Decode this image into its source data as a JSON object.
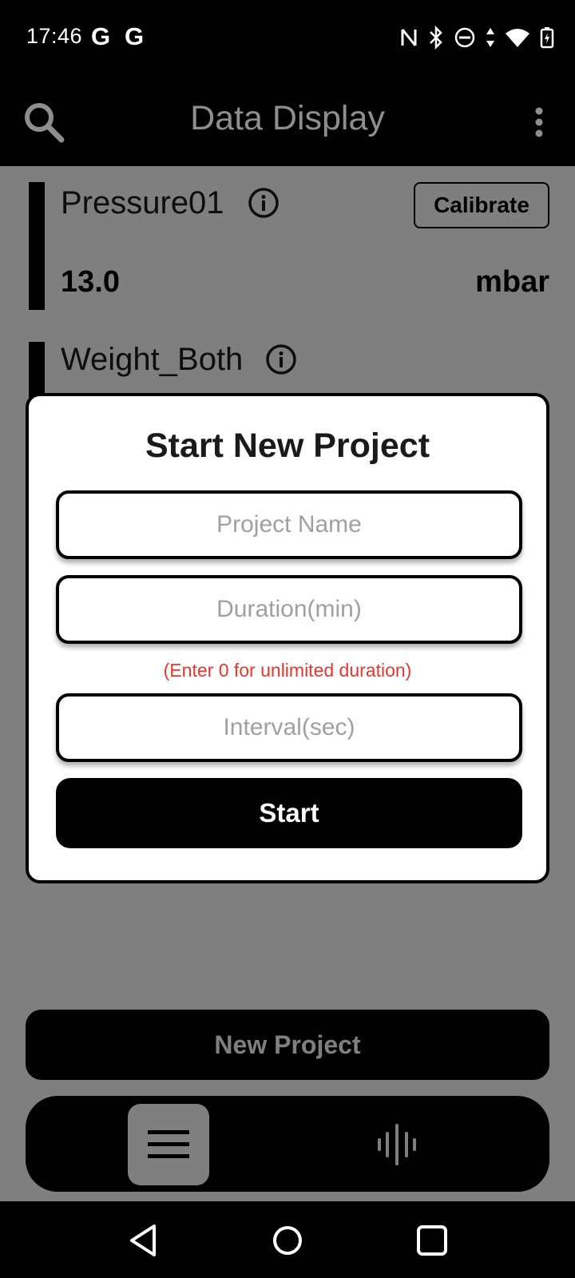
{
  "status_bar": {
    "time": "17:46",
    "notification_icons": [
      "google-g-icon",
      "google-g-icon"
    ],
    "system_icons": [
      "nfc-icon",
      "bluetooth-icon",
      "do-not-disturb-icon",
      "data-transfer-icon",
      "wifi-icon",
      "battery-charging-icon"
    ]
  },
  "app_bar": {
    "title": "Data Display",
    "left_icon": "search-icon",
    "right_icon": "more-vert-icon"
  },
  "sensors": [
    {
      "name": "Pressure01",
      "value": "13.0",
      "unit": "mbar",
      "action_label": "Calibrate"
    },
    {
      "name": "Weight_Both"
    }
  ],
  "footer": {
    "new_project_label": "New Project",
    "nav_items": [
      {
        "icon": "menu-icon",
        "active": true
      },
      {
        "icon": "waveform-icon",
        "active": false
      }
    ]
  },
  "dialog": {
    "title": "Start New Project",
    "fields": {
      "project_name_placeholder": "Project Name",
      "duration_placeholder": "Duration(min)",
      "interval_placeholder": "Interval(sec)"
    },
    "hint": "(Enter 0 for unlimited duration)",
    "start_label": "Start"
  },
  "system_nav": [
    "back-icon",
    "home-icon",
    "recents-icon"
  ],
  "colors": {
    "accent": "#000000",
    "hint_red": "#e8362e",
    "placeholder_gray": "#a0a0a0",
    "title_gray": "#8e8e8e"
  }
}
